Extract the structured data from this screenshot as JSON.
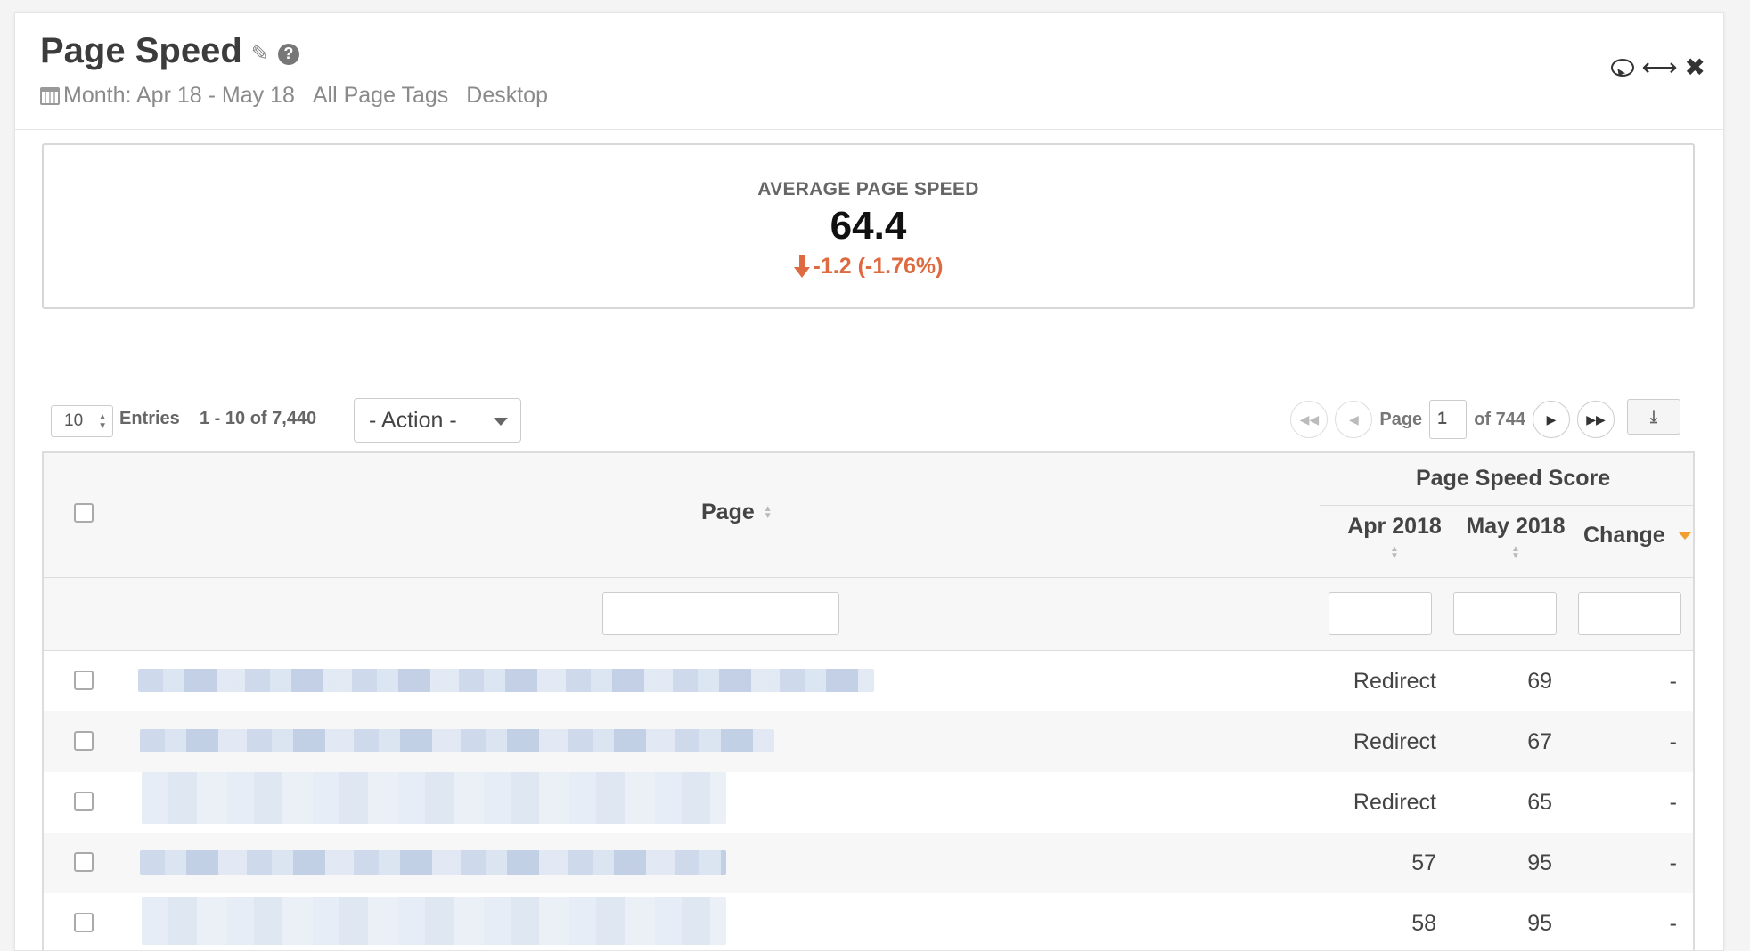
{
  "widget": {
    "title": "Page Speed",
    "subtitle": {
      "date_range": "Month: Apr 18 - May 18",
      "page_tags": "All Page Tags",
      "device": "Desktop"
    },
    "icons": [
      "pencil-icon",
      "help-icon",
      "comment-icon",
      "resize-icon",
      "close-icon"
    ]
  },
  "summary": {
    "label": "AVERAGE PAGE SPEED",
    "value": "64.4",
    "change": "-1.2 (-1.76%)",
    "change_color": "#dd6a40"
  },
  "controls": {
    "entries_value": "10",
    "entries_label": "Entries",
    "range_label": "1 - 10 of 7,440",
    "action_label": "- Action -",
    "page_label": "Page",
    "page_value": "1",
    "page_total": "of 744"
  },
  "table": {
    "headers": {
      "page": "Page",
      "group": "Page Speed Score",
      "apr": "Apr 2018",
      "may": "May 2018",
      "change": "Change"
    },
    "sort_accent": "#f0a030",
    "rows": [
      {
        "apr": "Redirect",
        "may": "69",
        "change": "-"
      },
      {
        "apr": "Redirect",
        "may": "67",
        "change": "-"
      },
      {
        "apr": "Redirect",
        "may": "65",
        "change": "-"
      },
      {
        "apr": "57",
        "may": "95",
        "change": "-"
      },
      {
        "apr": "58",
        "may": "95",
        "change": "-"
      }
    ]
  }
}
